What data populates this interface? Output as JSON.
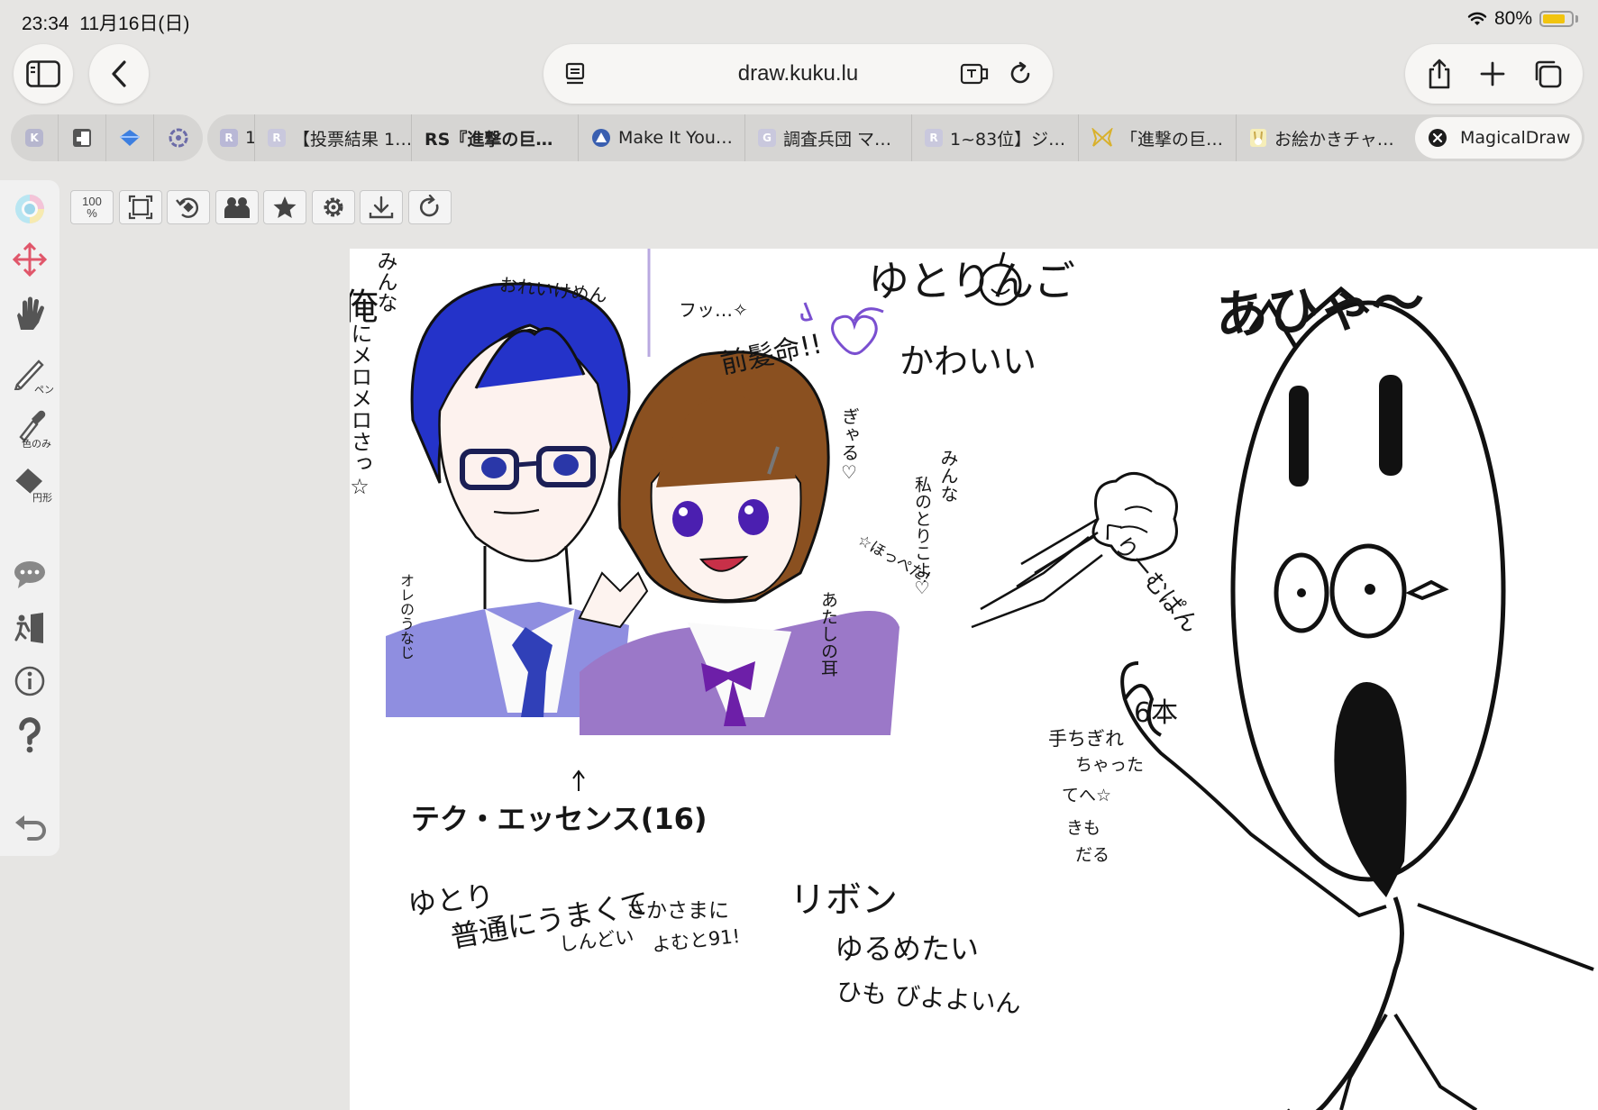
{
  "status": {
    "time": "23:34",
    "date": "11月16日(日)",
    "battery": "80%",
    "battery_level": 0.8
  },
  "browser": {
    "url": "draw.kuku.lu",
    "pinned_tabs": [
      {
        "icon": "k-icon",
        "letter": "K"
      },
      {
        "icon": "lock-doc-icon",
        "letter": ""
      },
      {
        "icon": "diamond-icon",
        "letter": ""
      },
      {
        "icon": "flower-icon",
        "letter": ""
      }
    ],
    "tabs": [
      {
        "label": "1·",
        "fav": "R",
        "color": "#b9b8d6"
      },
      {
        "label": "【投票結果 1…",
        "fav": "R",
        "color": "#c9c8dd"
      },
      {
        "label": "RS『進撃の巨…",
        "fav": "",
        "color": ""
      },
      {
        "label": "Make It You…",
        "fav": "",
        "color": "#3a5fb0"
      },
      {
        "label": "調査兵団 マ…",
        "fav": "G",
        "color": "#c9c8dd"
      },
      {
        "label": "1~83位】ジ…",
        "fav": "R",
        "color": "#c9c8dd"
      },
      {
        "label": "「進撃の巨…",
        "fav": "",
        "color": "#e3c53a"
      },
      {
        "label": "お絵かきチャ…",
        "fav": "",
        "color": "#f0e3a0"
      },
      {
        "label": "MagicalDraw",
        "fav": "",
        "color": ""
      }
    ]
  },
  "app": {
    "zoom_top": "100",
    "zoom_bottom": "%",
    "tools": {
      "pen": "ペン",
      "color_only": "色のみ",
      "ellipse": "円形"
    }
  },
  "drawing": {
    "minna_vertical": "みんな",
    "ore_ni": "俺",
    "mero_vertical": "にメロメロさっ☆",
    "oreike": "おれいけめん",
    "futsu": "フッ…✧",
    "maegami": "前髪命!!",
    "yutoringo": "ゆとりんご",
    "kawaii": "かわいい",
    "gyaru": "ぎゃる♡",
    "minna2": "みんな",
    "watashi": "私のとりこよ♡",
    "hoppe": "☆ほっぺた!",
    "mimi": "あたしの耳",
    "unaji": "オレのうなじ",
    "ahiya": "あひゃ〜",
    "cream": "くりーむぱん",
    "rokuhon": "6本",
    "chigire1": "手ちぎれ",
    "chigire2": "ちゃった",
    "chigire3": "てへ☆",
    "kimo1": "きも",
    "kimo2": "だる",
    "title": "テク・エッセンス(16)",
    "yutori": "ゆとり",
    "futsuu": "普通にうまくて",
    "sakasama": "さかさまに",
    "shindoi": "しんどい",
    "yomu": "よむと91!",
    "ribbon": "リボン",
    "yurumetai": "ゆるめたい",
    "himo": "ひも びよよいん"
  }
}
